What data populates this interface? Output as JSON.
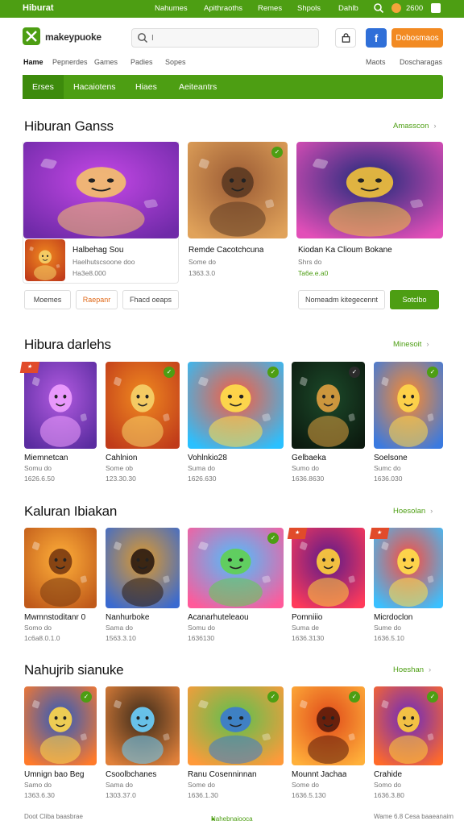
{
  "topbar": {
    "brand": "Hiburat",
    "links": [
      "Nahumes",
      "Apithraoths",
      "Remes",
      "Shpols",
      "Dahlb"
    ],
    "coins": "2600",
    "colors": {
      "bar": "#4d9e13"
    }
  },
  "header": {
    "logo_text": "makeypuoke",
    "search_placeholder": "I",
    "action_label": "Dobosmaos"
  },
  "subnav": {
    "left": [
      "Hame",
      "Pepnerdes",
      "Games",
      "Padies",
      "Sopes"
    ],
    "right": [
      "Maots",
      "Doscharagas"
    ]
  },
  "greennav": [
    "Erses",
    "Hacaiotens",
    "Hiaes",
    "Aeiteantrs"
  ],
  "sections": [
    {
      "title": "Hiburan Ganss",
      "more": "Amasscon",
      "featured": [
        {
          "title": "Halbehag Sou",
          "sub": "Haelhutscsoone doo",
          "price": "Ha3e8.000",
          "art": "mage"
        },
        {
          "title": "Remde Cacotchcuna",
          "sub": "Some do",
          "price": "1363.3.0",
          "art": "warrior"
        },
        {
          "title": "Kiodan Ka Clioum Bokane",
          "sub": "Shrs do",
          "price": "Ta6e.e.a0",
          "art": "casino"
        }
      ],
      "buttons": [
        "Moemes",
        "Raepanr",
        "Fhacd oeaps",
        "Nomeadm kitegecennt",
        "Sotclbo"
      ]
    },
    {
      "title": "Hibura darlehs",
      "more": "Minesoit",
      "cards": [
        {
          "title": "Miemnetcan",
          "sub": "Somu do",
          "price": "1626.6.50",
          "art": "wizard",
          "badge": "tl"
        },
        {
          "title": "Cahlnion",
          "sub": "Some ob",
          "price": "123.30.30",
          "art": "boy",
          "badge": "tr"
        },
        {
          "title": "Vohlnkio28",
          "sub": "Suma do",
          "price": "1626.630",
          "art": "hbuiha",
          "badge": "tr"
        },
        {
          "title": "Gelbaeka",
          "sub": "Sumo do",
          "price": "1636.8630",
          "art": "dark",
          "badge": "dark"
        },
        {
          "title": "Soelsone",
          "sub": "Sumc do",
          "price": "1636.030",
          "art": "dohcks",
          "badge": "tr"
        }
      ]
    },
    {
      "title": "Kaluran Ibiakan",
      "more": "Hoesolan",
      "cards": [
        {
          "title": "Mwmnstoditanr 0",
          "sub": "Somo do",
          "price": "1c6a8.0.1.0",
          "art": "lion",
          "badge": "none"
        },
        {
          "title": "Nanhurboke",
          "sub": "Sama do",
          "price": "1563.3.10",
          "art": "pirate",
          "badge": "none"
        },
        {
          "title": "Acanarhuteleaou",
          "sub": "Somu do",
          "price": "1636130",
          "art": "party",
          "badge": "tr"
        },
        {
          "title": "Pomniiio",
          "sub": "Suma de",
          "price": "1636.3130",
          "art": "gehuno",
          "badge": "tl"
        },
        {
          "title": "Micrdoclon",
          "sub": "Sume do",
          "price": "1636.5.10",
          "art": "soekun",
          "badge": "tl"
        }
      ]
    },
    {
      "title": "Nahujrib sianuke",
      "more": "Hoeshan",
      "cards": [
        {
          "title": "Umnign bao Beg",
          "sub": "Samo do",
          "price": "1363.6.30",
          "art": "koebera",
          "badge": "tr"
        },
        {
          "title": "Csoolbchanes",
          "sub": "Sama do",
          "price": "1303.37.0",
          "art": "sukes",
          "badge": "none"
        },
        {
          "title": "Ranu Cosenninnan",
          "sub": "Some do",
          "price": "1636.1.30",
          "art": "hero",
          "badge": "tr"
        },
        {
          "title": "Mounnt Jachaa",
          "sub": "Some do",
          "price": "1636.5.130",
          "art": "fox",
          "badge": "tr"
        },
        {
          "title": "Crahide",
          "sub": "Somo do",
          "price": "1636.3.80",
          "art": "raonaa",
          "badge": "tr"
        }
      ]
    }
  ],
  "footer": {
    "left": "Doot Cliba baasbrae",
    "center": "Nahebnaiooca",
    "right": "Wame 6.8 Cesa baaeanaim"
  }
}
